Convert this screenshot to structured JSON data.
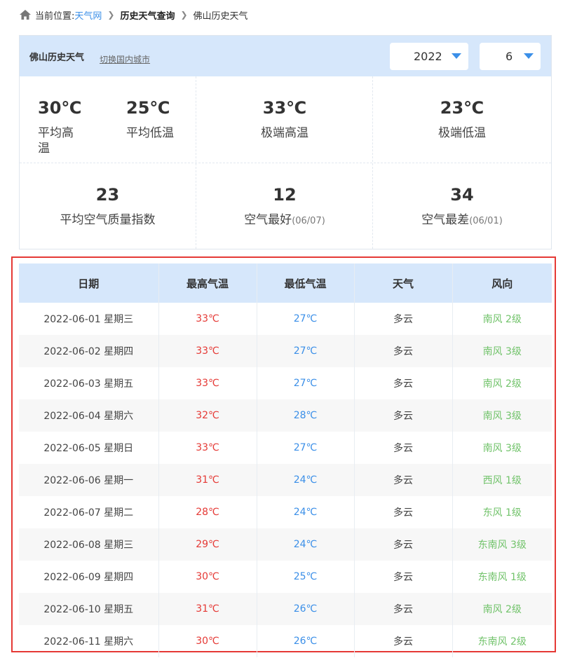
{
  "breadcrumb": {
    "prefix": "当前位置:",
    "site": "天气网",
    "section": "历史天气查询",
    "current": "佛山历史天气"
  },
  "header": {
    "title": "佛山历史天气",
    "switch_city": "切换国内城市",
    "year": "2022",
    "month": "6"
  },
  "stats": {
    "avg_high": {
      "value": "30℃",
      "label": "平均高温"
    },
    "avg_low": {
      "value": "25℃",
      "label": "平均低温"
    },
    "extreme_high": {
      "value": "33℃",
      "label": "极端高温"
    },
    "extreme_low": {
      "value": "23℃",
      "label": "极端低温"
    },
    "aqi_avg": {
      "value": "23",
      "label": "平均空气质量指数"
    },
    "aqi_best": {
      "value": "12",
      "label": "空气最好",
      "date": "(06/07)"
    },
    "aqi_worst": {
      "value": "34",
      "label": "空气最差",
      "date": "(06/01)"
    }
  },
  "table": {
    "headers": [
      "日期",
      "最高气温",
      "最低气温",
      "天气",
      "风向"
    ],
    "rows": [
      {
        "date": "2022-06-01 星期三",
        "high": "33℃",
        "low": "27℃",
        "weather": "多云",
        "wind": "南风 2级"
      },
      {
        "date": "2022-06-02 星期四",
        "high": "33℃",
        "low": "27℃",
        "weather": "多云",
        "wind": "南风 3级"
      },
      {
        "date": "2022-06-03 星期五",
        "high": "33℃",
        "low": "27℃",
        "weather": "多云",
        "wind": "南风 2级"
      },
      {
        "date": "2022-06-04 星期六",
        "high": "32℃",
        "low": "28℃",
        "weather": "多云",
        "wind": "南风 3级"
      },
      {
        "date": "2022-06-05 星期日",
        "high": "33℃",
        "low": "27℃",
        "weather": "多云",
        "wind": "南风 3级"
      },
      {
        "date": "2022-06-06 星期一",
        "high": "31℃",
        "low": "24℃",
        "weather": "多云",
        "wind": "西风 1级"
      },
      {
        "date": "2022-06-07 星期二",
        "high": "28℃",
        "low": "24℃",
        "weather": "多云",
        "wind": "东风 1级"
      },
      {
        "date": "2022-06-08 星期三",
        "high": "29℃",
        "low": "24℃",
        "weather": "多云",
        "wind": "东南风 3级"
      },
      {
        "date": "2022-06-09 星期四",
        "high": "30℃",
        "low": "25℃",
        "weather": "多云",
        "wind": "东南风 1级"
      },
      {
        "date": "2022-06-10 星期五",
        "high": "31℃",
        "low": "26℃",
        "weather": "多云",
        "wind": "南风 2级"
      },
      {
        "date": "2022-06-11 星期六",
        "high": "30℃",
        "low": "26℃",
        "weather": "多云",
        "wind": "东南风 2级"
      }
    ]
  },
  "colors": {
    "accent": "#3b8fe8",
    "header_bg": "#d6e7fb",
    "high_temp": "#e53935",
    "low_temp": "#3b8fe8",
    "wind": "#72c36b",
    "highlight_frame": "#e53935"
  }
}
